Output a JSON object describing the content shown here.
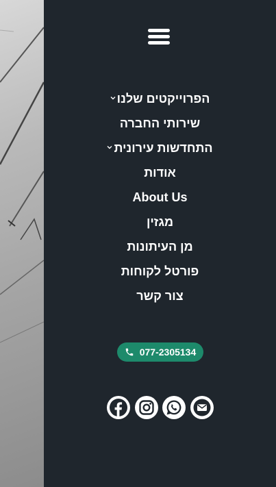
{
  "menu": {
    "items": [
      {
        "label": "הפרוייקטים שלנו",
        "has_dropdown": true
      },
      {
        "label": "שירותי החברה",
        "has_dropdown": false
      },
      {
        "label": "התחדשות עירונית",
        "has_dropdown": true
      },
      {
        "label": "אודות",
        "has_dropdown": false
      },
      {
        "label": "About Us",
        "has_dropdown": false
      },
      {
        "label": "מגזין",
        "has_dropdown": false
      },
      {
        "label": "מן העיתונות",
        "has_dropdown": false
      },
      {
        "label": "פורטל לקוחות",
        "has_dropdown": false
      },
      {
        "label": "צור קשר",
        "has_dropdown": false
      }
    ]
  },
  "contact": {
    "phone": "077-2305134"
  },
  "social": [
    "facebook-icon",
    "instagram-icon",
    "whatsapp-icon",
    "email-icon"
  ],
  "colors": {
    "panel_bg": "#1f262d",
    "accent": "#1d8a6b",
    "text": "#ffffff"
  }
}
